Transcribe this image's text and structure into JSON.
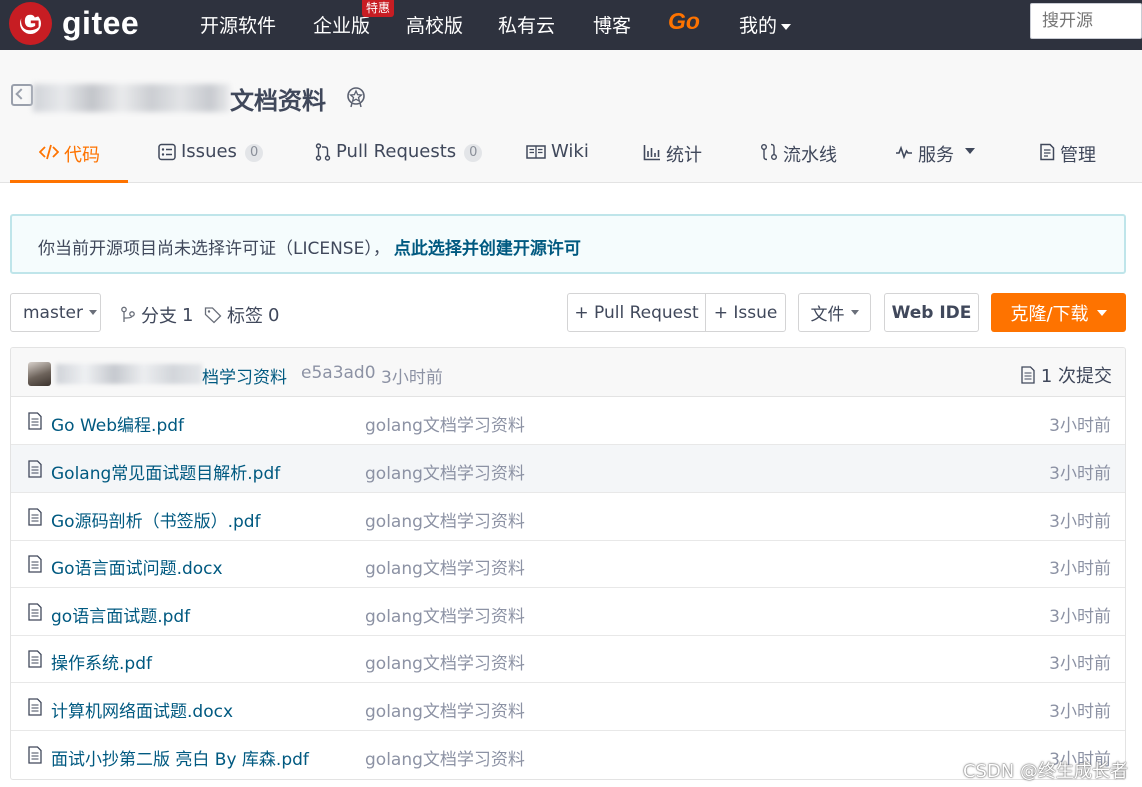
{
  "topnav": {
    "logo_text": "gitee",
    "logo_glyph": "G",
    "items": [
      {
        "label": "开源软件"
      },
      {
        "label": "企业版"
      },
      {
        "label": "高校版"
      },
      {
        "label": "私有云"
      },
      {
        "label": "博客"
      },
      {
        "label": "Go"
      },
      {
        "label": "我的"
      }
    ],
    "badge": "特惠",
    "search_placeholder": "搜开源",
    "colors": {
      "bar": "#2e323e",
      "brand": "#c71d23",
      "go": "#fe7300"
    }
  },
  "repo": {
    "title_visible": "文档资料"
  },
  "tabs": [
    {
      "label": "代码",
      "icon": "code-icon",
      "active": true
    },
    {
      "label": "Issues",
      "icon": "issues-icon",
      "count": "0"
    },
    {
      "label": "Pull Requests",
      "icon": "pull-request-icon",
      "count": "0"
    },
    {
      "label": "Wiki",
      "icon": "wiki-icon"
    },
    {
      "label": "统计",
      "icon": "stats-icon"
    },
    {
      "label": "流水线",
      "icon": "pipeline-icon"
    },
    {
      "label": "服务",
      "icon": "service-icon"
    },
    {
      "label": "管理",
      "icon": "manage-icon"
    }
  ],
  "notice": {
    "text": "你当前开源项目尚未选择许可证（LICENSE），",
    "link": "点此选择并创建开源许可"
  },
  "toolbar": {
    "branch": "master",
    "branches_label": "分支",
    "branches_count": "1",
    "tags_label": "标签",
    "tags_count": "0",
    "pull_request_btn": "+ Pull Request",
    "issue_btn": "+ Issue",
    "file_btn": "文件",
    "webide_btn": "Web IDE",
    "clone_btn": "克隆/下载"
  },
  "commit": {
    "message_visible": "档学习资料",
    "hash": "e5a3ad0",
    "time": "3小时前",
    "count_label": "1 次提交"
  },
  "files": [
    {
      "name": "Go Web编程.pdf",
      "message": "golang文档学习资料",
      "time": "3小时前"
    },
    {
      "name": "Golang常见面试题目解析.pdf",
      "message": "golang文档学习资料",
      "time": "3小时前"
    },
    {
      "name": "Go源码剖析（书签版）.pdf",
      "message": "golang文档学习资料",
      "time": "3小时前"
    },
    {
      "name": "Go语言面试问题.docx",
      "message": "golang文档学习资料",
      "time": "3小时前"
    },
    {
      "name": "go语言面试题.pdf",
      "message": "golang文档学习资料",
      "time": "3小时前"
    },
    {
      "name": "操作系统.pdf",
      "message": "golang文档学习资料",
      "time": "3小时前"
    },
    {
      "name": "计算机网络面试题.docx",
      "message": "golang文档学习资料",
      "time": "3小时前"
    },
    {
      "name": "面试小抄第二版 亮白 By 库森.pdf",
      "message": "golang文档学习资料",
      "time": "3小时前"
    }
  ],
  "watermark": "CSDN @终生成长者"
}
